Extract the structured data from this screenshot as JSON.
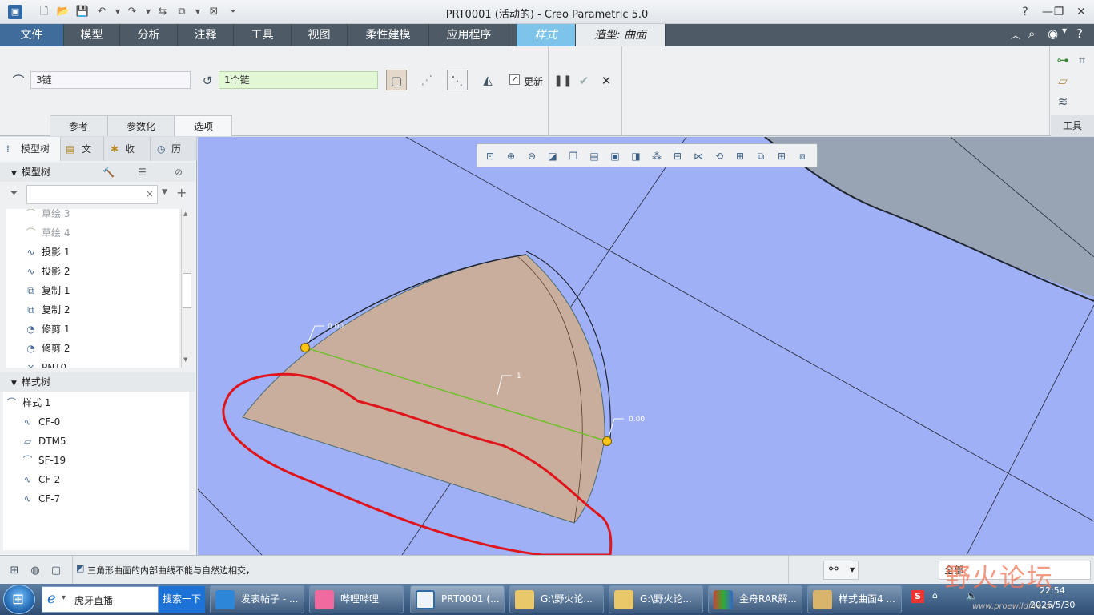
{
  "window": {
    "title": "PRT0001 (活动的) - Creo Parametric 5.0",
    "controls": [
      "?",
      "—",
      "❐",
      "✕"
    ]
  },
  "menu_tabs": [
    {
      "label": "文件"
    },
    {
      "label": "模型"
    },
    {
      "label": "分析"
    },
    {
      "label": "注释"
    },
    {
      "label": "工具"
    },
    {
      "label": "视图"
    },
    {
      "label": "柔性建模"
    },
    {
      "label": "应用程序"
    },
    {
      "label": "样式"
    },
    {
      "label": "造型: 曲面"
    }
  ],
  "ribbon": {
    "chain_primary": "3链",
    "chain_secondary": "1个链",
    "update_label": "更新",
    "update_checked": true,
    "subtabs": [
      "参考",
      "参数化",
      "选项"
    ],
    "tools_label": "工具"
  },
  "left_panel": {
    "tabs": [
      "模型树",
      "文",
      "收",
      "历"
    ],
    "model_tree_title": "模型树",
    "model_tree_items": [
      {
        "label": "草绘 3",
        "icon": "sketch-icon",
        "faded": true
      },
      {
        "label": "草绘 4",
        "icon": "sketch-icon",
        "faded": true
      },
      {
        "label": "投影 1",
        "icon": "projection-icon",
        "faded": false
      },
      {
        "label": "投影 2",
        "icon": "projection-icon",
        "faded": false
      },
      {
        "label": "复制 1",
        "icon": "copy-icon",
        "faded": false
      },
      {
        "label": "复制 2",
        "icon": "copy-icon",
        "faded": false
      },
      {
        "label": "修剪 1",
        "icon": "trim-icon",
        "faded": false
      },
      {
        "label": "修剪 2",
        "icon": "trim-icon",
        "faded": false
      },
      {
        "label": "PNT0",
        "icon": "point-icon",
        "faded": false
      }
    ],
    "style_tree_title": "样式树",
    "style_tree_items": [
      {
        "label": "样式 1",
        "indent": 0
      },
      {
        "label": "CF-0",
        "indent": 1
      },
      {
        "label": "DTM5",
        "indent": 1
      },
      {
        "label": "SF-19",
        "indent": 1
      },
      {
        "label": "CF-2",
        "indent": 1
      },
      {
        "label": "CF-7",
        "indent": 1
      }
    ]
  },
  "viewport": {
    "dimension_labels": [
      "0.00",
      "1",
      "0.00"
    ],
    "toolbar_icons": [
      "refit-icon",
      "zoom-in-icon",
      "zoom-out-icon",
      "repaint-icon",
      "shading-icon",
      "saved-views-icon",
      "view-manager-icon",
      "perspective-icon",
      "datum-display-icon",
      "plane-display-icon",
      "axis-display-icon",
      "spin-center-icon",
      "annotation-icon",
      "grid-icon",
      "curvature-icon",
      "section-icon"
    ]
  },
  "status": {
    "message": "三角形曲面的内部曲线不能与自然边相交，",
    "filter_value": "全部"
  },
  "taskbar": {
    "search_text": "虎牙直播",
    "search_button": "搜索一下",
    "tasks": [
      "发表帖子 - ...",
      "哔哩哔哩",
      "PRT0001 (...",
      "G:\\野火论...",
      "G:\\野火论...",
      "金舟RAR解...",
      "样式曲面4 ..."
    ],
    "clock_time": "22:54",
    "clock_date": "2026/5/30",
    "watermark": "野火论坛",
    "watermark_url": "www.proewildfire.cn"
  },
  "colors": {
    "viewport_bg": "#9fb0f6",
    "surface_fill": "#c9ae9d",
    "sketch_red": "#e0151b",
    "handle_yellow": "#ffc414"
  }
}
